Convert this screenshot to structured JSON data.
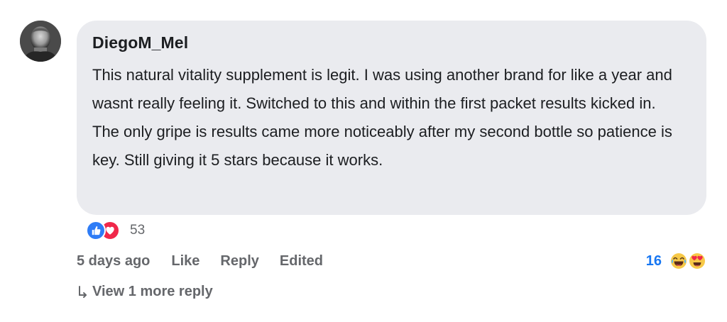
{
  "comment": {
    "author": "DiegoM_Mel",
    "text": "This natural vitality supplement is legit. I was using another brand for like a year and wasnt really feeling it. Switched to this and within the first packet results kicked in. The only gripe is results came more noticeably after my second bottle so patience is key. Still giving it 5 stars because it works.",
    "avatar_icon": "user-photo-avatar"
  },
  "reactions": {
    "icons": [
      "thumbs-up-icon",
      "heart-icon"
    ],
    "count": "53"
  },
  "actions": {
    "timestamp": "5 days ago",
    "like_label": "Like",
    "reply_label": "Reply",
    "edited_label": "Edited"
  },
  "reply_reactions": {
    "count": "16",
    "icons": [
      "laughing-emoji-icon",
      "heart-eyes-emoji-icon"
    ]
  },
  "replies": {
    "view_more_label": "View 1 more reply"
  },
  "colors": {
    "bubble_bg": "#eaebef",
    "link_blue": "#1877f2",
    "muted_text": "#65676b",
    "like_blue": "#2e7cf6",
    "love_red": "#f0284a"
  }
}
